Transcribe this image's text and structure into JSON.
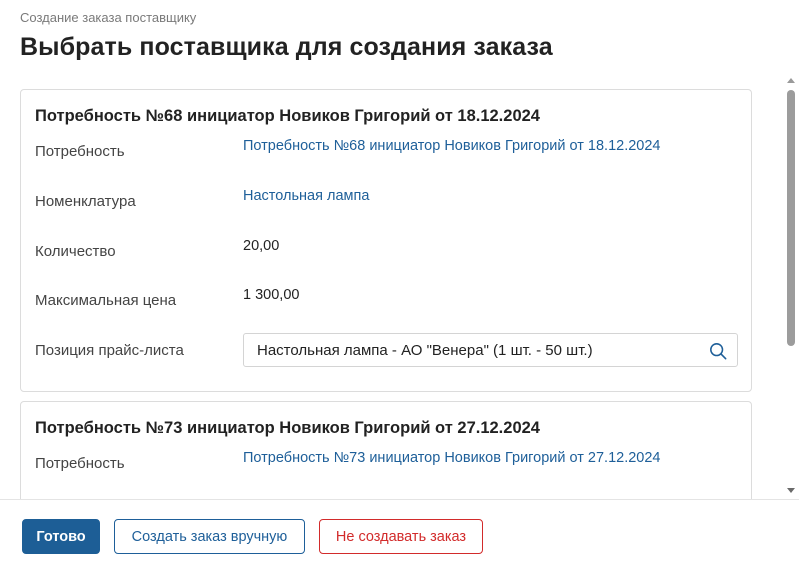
{
  "breadcrumb": "Создание заказа поставщику",
  "title": "Выбрать поставщика для создания заказа",
  "cards": [
    {
      "title": "Потребность №68 инициатор Новиков Григорий от 18.12.2024",
      "need_label": "Потребность",
      "need_value": "Потребность №68 инициатор Новиков Григорий от 18.12.2024",
      "nomenclature_label": "Номенклатура",
      "nomenclature_value": "Настольная лампа",
      "quantity_label": "Количество",
      "quantity_value": "20,00",
      "max_price_label": "Максимальная цена",
      "max_price_value": "1 300,00",
      "price_position_label": "Позиция прайс-листа",
      "price_position_value": "Настольная лампа - АО \"Венера\" (1 шт. - 50 шт.)"
    },
    {
      "title": "Потребность №73 инициатор Новиков Григорий от 27.12.2024",
      "need_label": "Потребность",
      "need_value": "Потребность №73 инициатор Новиков Григорий от 27.12.2024"
    }
  ],
  "footer": {
    "done_label": "Готово",
    "manual_label": "Создать заказ вручную",
    "skip_label": "Не создавать заказ"
  },
  "colors": {
    "primary": "#1d5e96",
    "link": "#1e5f99",
    "danger": "#d22b2b"
  },
  "icons": [
    "search-icon"
  ]
}
